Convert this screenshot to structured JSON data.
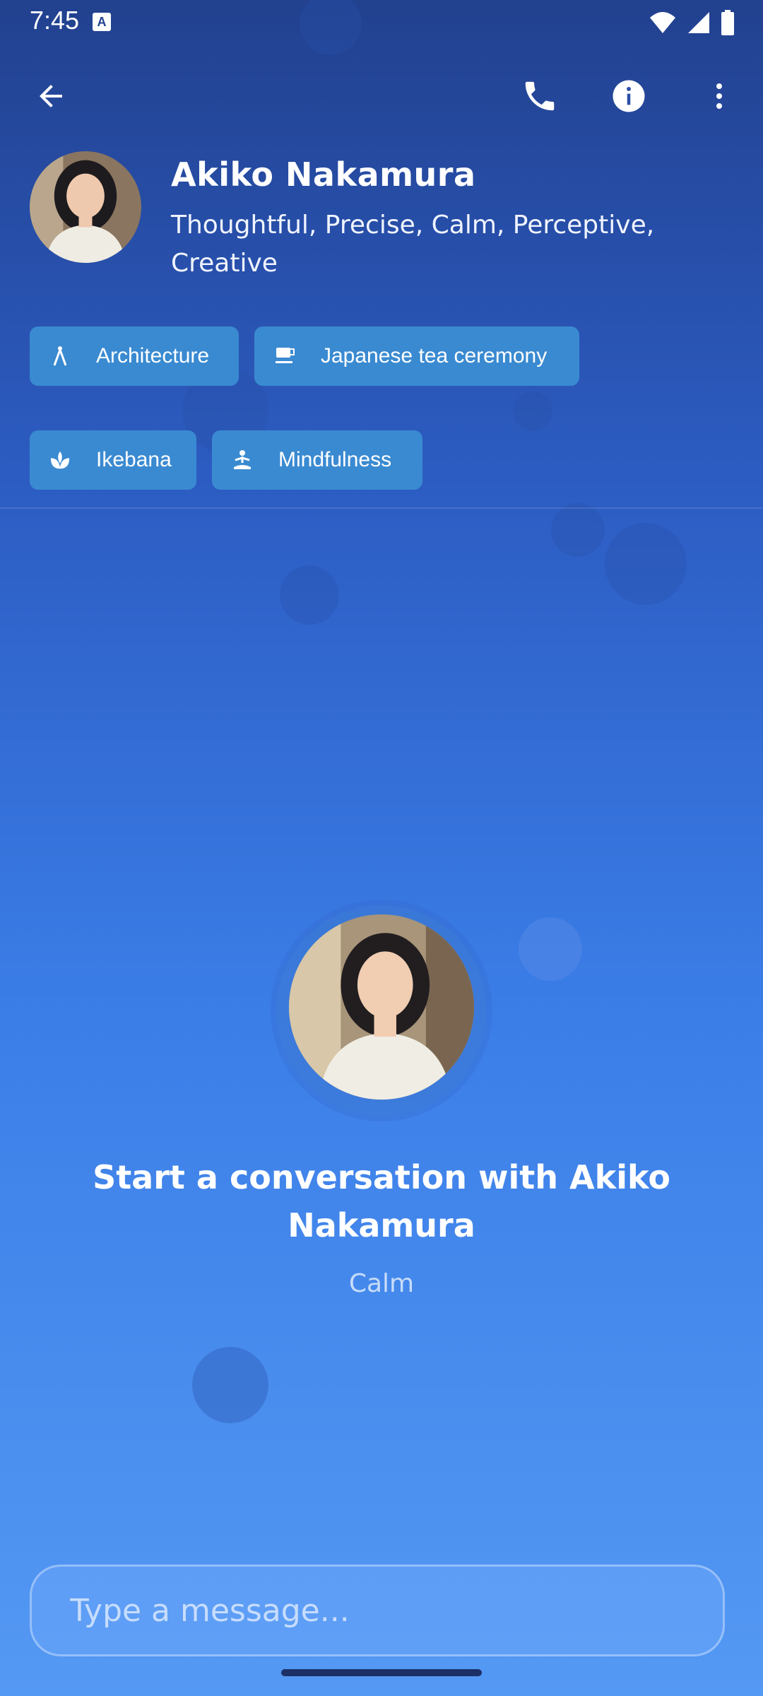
{
  "status_bar": {
    "time": "7:45",
    "notif_icon_label": "A"
  },
  "header": {
    "back_icon": "arrow-back-icon",
    "call_icon": "phone-icon",
    "info_icon": "info-icon",
    "more_icon": "more-vert-icon"
  },
  "profile": {
    "name": "Akiko Nakamura",
    "traits": "Thoughtful, Precise, Calm, Perceptive, Creative"
  },
  "interests": [
    {
      "label": "Architecture",
      "icon": "compass-icon"
    },
    {
      "label": "Japanese tea ceremony",
      "icon": "tea-cup-icon"
    },
    {
      "label": "Ikebana",
      "icon": "lotus-icon"
    },
    {
      "label": "Mindfulness",
      "icon": "meditation-icon"
    }
  ],
  "empty_state": {
    "title": "Start a conversation with Akiko Nakamura",
    "mood": "Calm"
  },
  "composer": {
    "placeholder": "Type a message..."
  },
  "colors": {
    "chip": "#3a8ad1",
    "bg_top": "#22418f",
    "bg_bottom": "#5499f3"
  }
}
